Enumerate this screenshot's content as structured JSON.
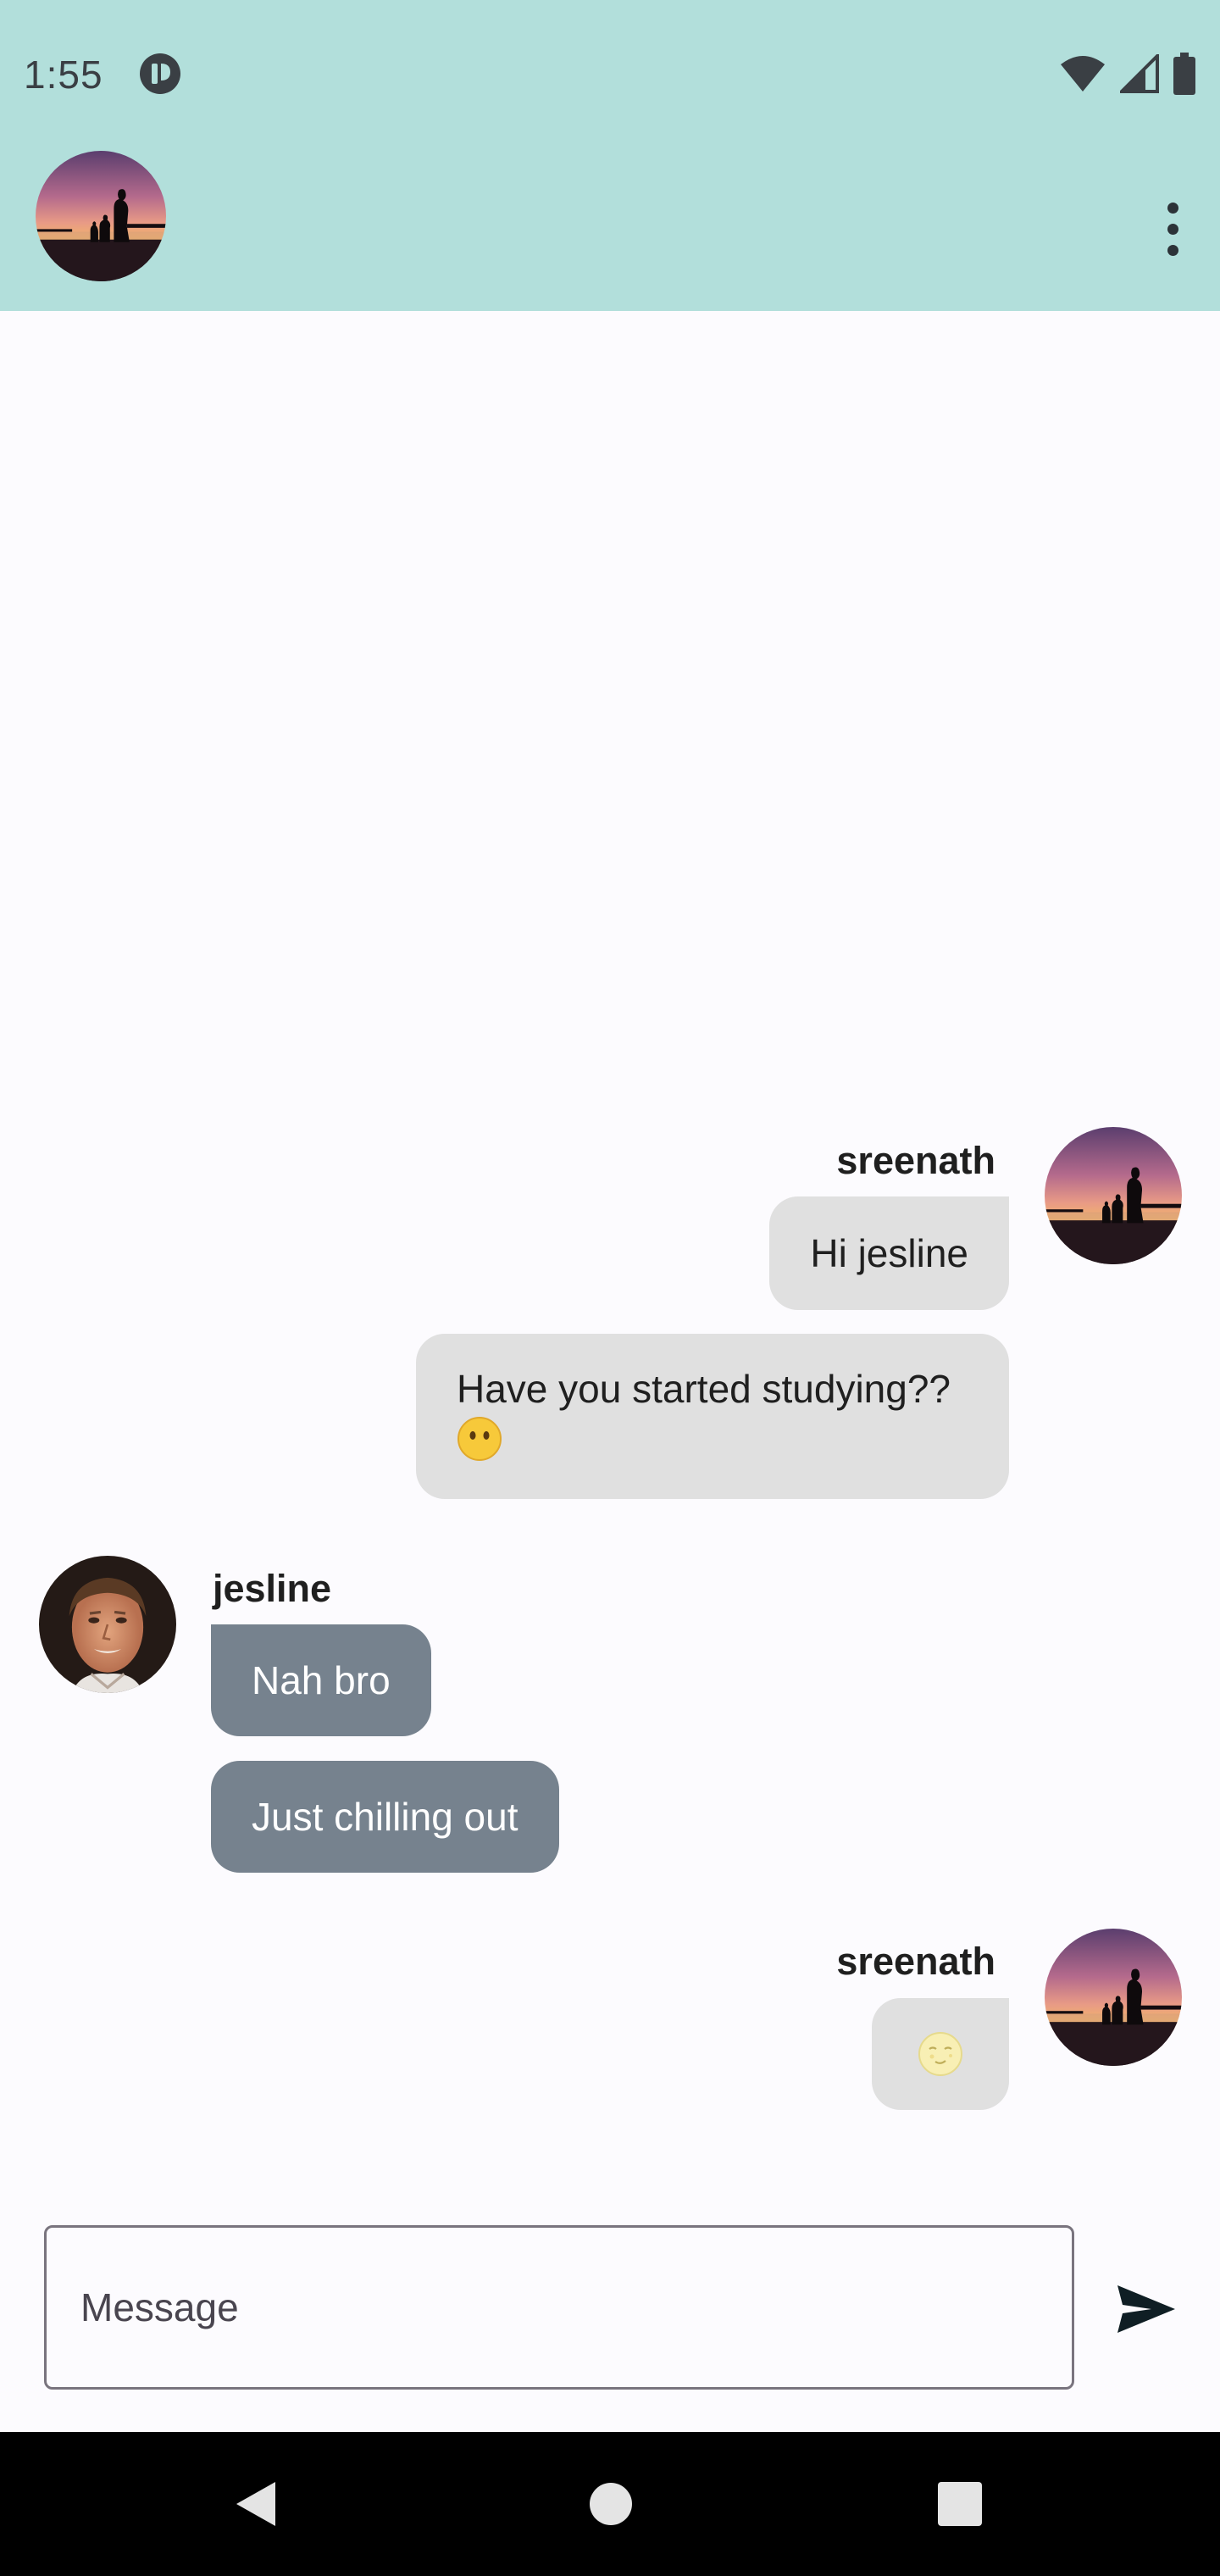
{
  "status_bar": {
    "time": "1:55",
    "icons": [
      "app-notification-icon",
      "wifi-icon",
      "cell-signal-icon",
      "battery-icon"
    ]
  },
  "app_bar": {
    "avatar": "profile-avatar",
    "menu_icon": "more-vert-icon"
  },
  "messages": [
    {
      "sender": "sreenath",
      "side": "right",
      "show_header": true,
      "text": "Hi jesline"
    },
    {
      "sender": "sreenath",
      "side": "right",
      "show_header": false,
      "text": "Have you started studying??",
      "emoji": "neutral-face-emoji"
    },
    {
      "sender": "jesline",
      "side": "left",
      "show_header": true,
      "text": "Nah bro"
    },
    {
      "sender": "jesline",
      "side": "left",
      "show_header": false,
      "text": "Just chilling out"
    },
    {
      "sender": "sreenath",
      "side": "right",
      "show_header": true,
      "text": "",
      "emoji": "moon-face-emoji"
    }
  ],
  "input": {
    "placeholder": "Message",
    "value": ""
  },
  "nav_bar": {
    "buttons": [
      "back",
      "home",
      "recents"
    ]
  },
  "colors": {
    "app_bar": "#B2DFDB",
    "background": "#FCFBFE",
    "my_bubble": "#E0E0E0",
    "their_bubble": "#76828E",
    "nav_bar": "#000000"
  }
}
